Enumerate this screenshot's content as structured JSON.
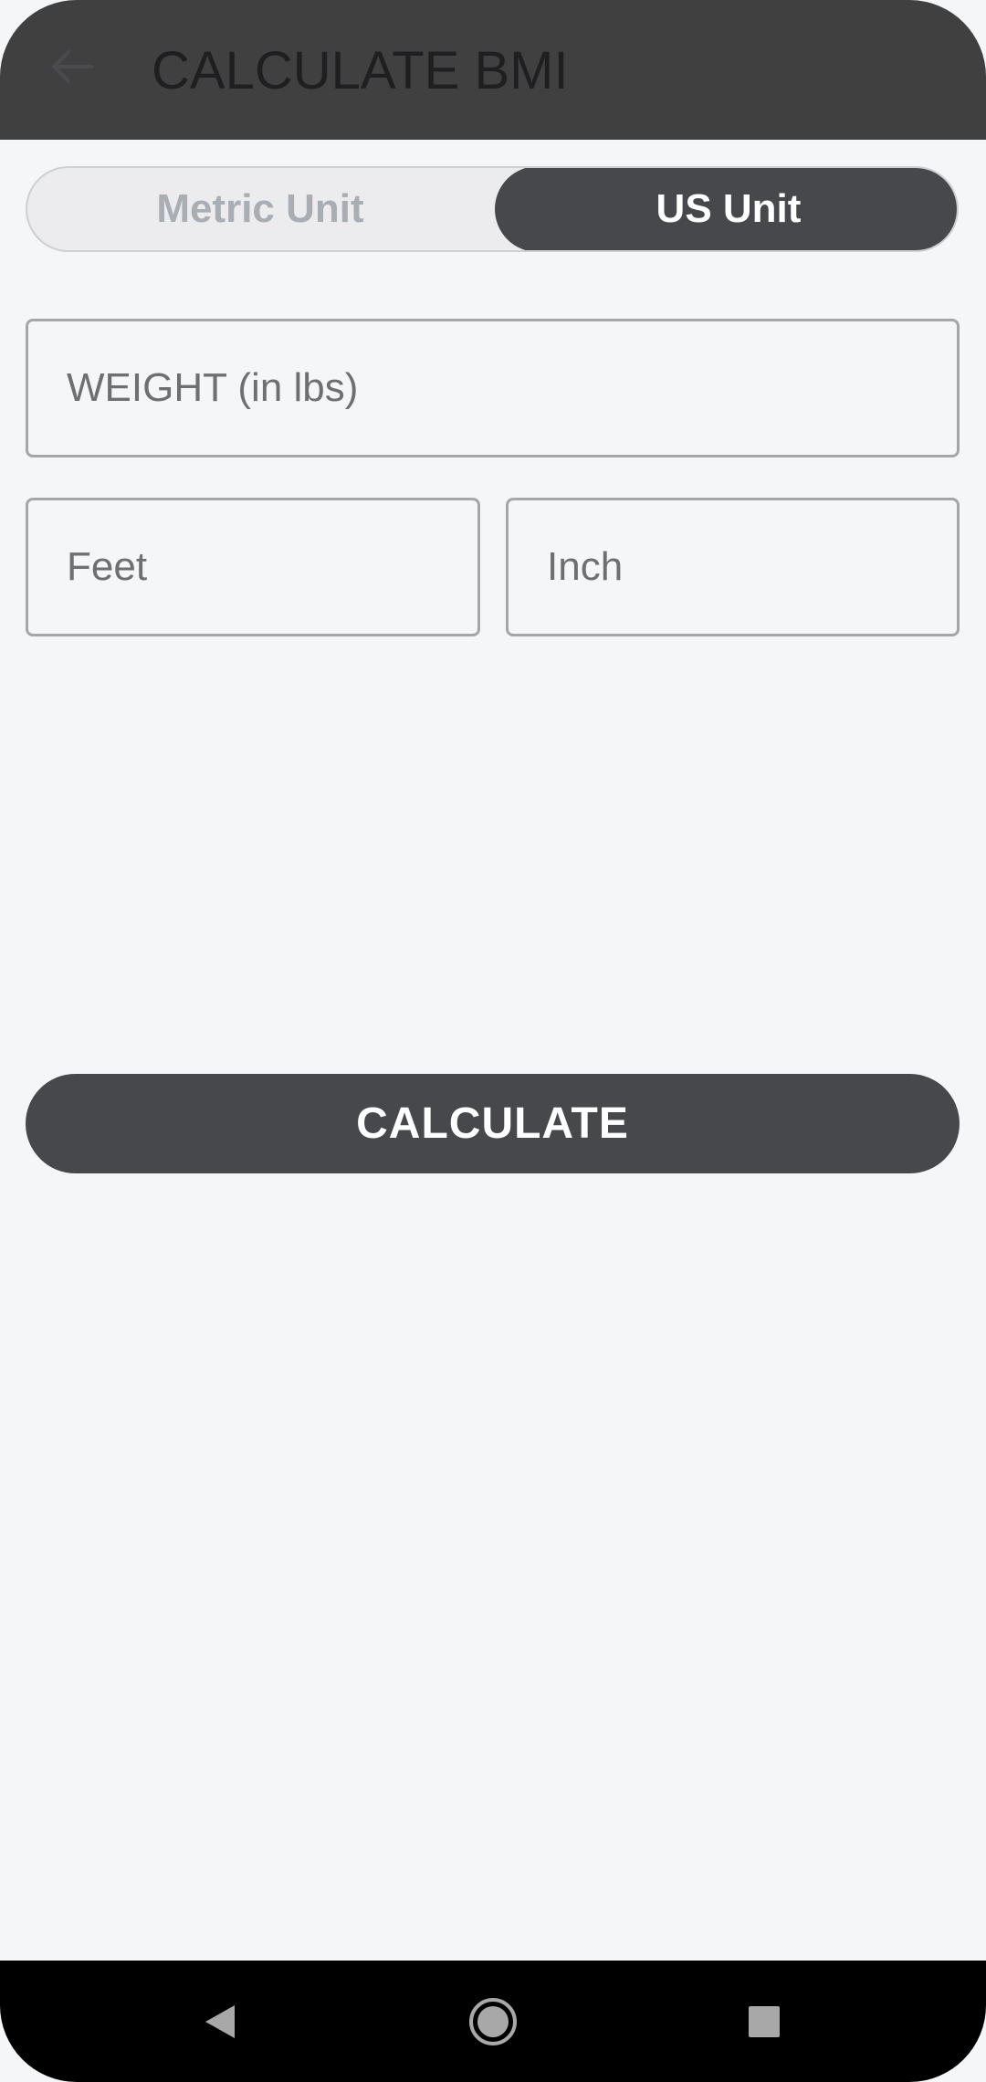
{
  "app_bar": {
    "title": "CALCULATE BMI",
    "back_icon": "arrow-left-icon"
  },
  "unit_toggle": {
    "options": [
      {
        "label": "Metric Unit",
        "selected": false
      },
      {
        "label": "US Unit",
        "selected": true
      }
    ]
  },
  "form": {
    "weight_placeholder": "WEIGHT (in lbs)",
    "feet_placeholder": "Feet",
    "inch_placeholder": "Inch",
    "weight_value": "",
    "feet_value": "",
    "inch_value": ""
  },
  "actions": {
    "calculate_label": "CALCULATE"
  },
  "nav_bar": {
    "back_icon": "nav-back-triangle-icon",
    "home_icon": "nav-home-circle-icon",
    "recents_icon": "nav-recents-square-icon"
  },
  "colors": {
    "app_bar": "#404041",
    "accent_dark": "#47484c",
    "background": "#f5f6f8",
    "field_border": "#a6a6a8",
    "muted_text": "#a9adb4"
  }
}
